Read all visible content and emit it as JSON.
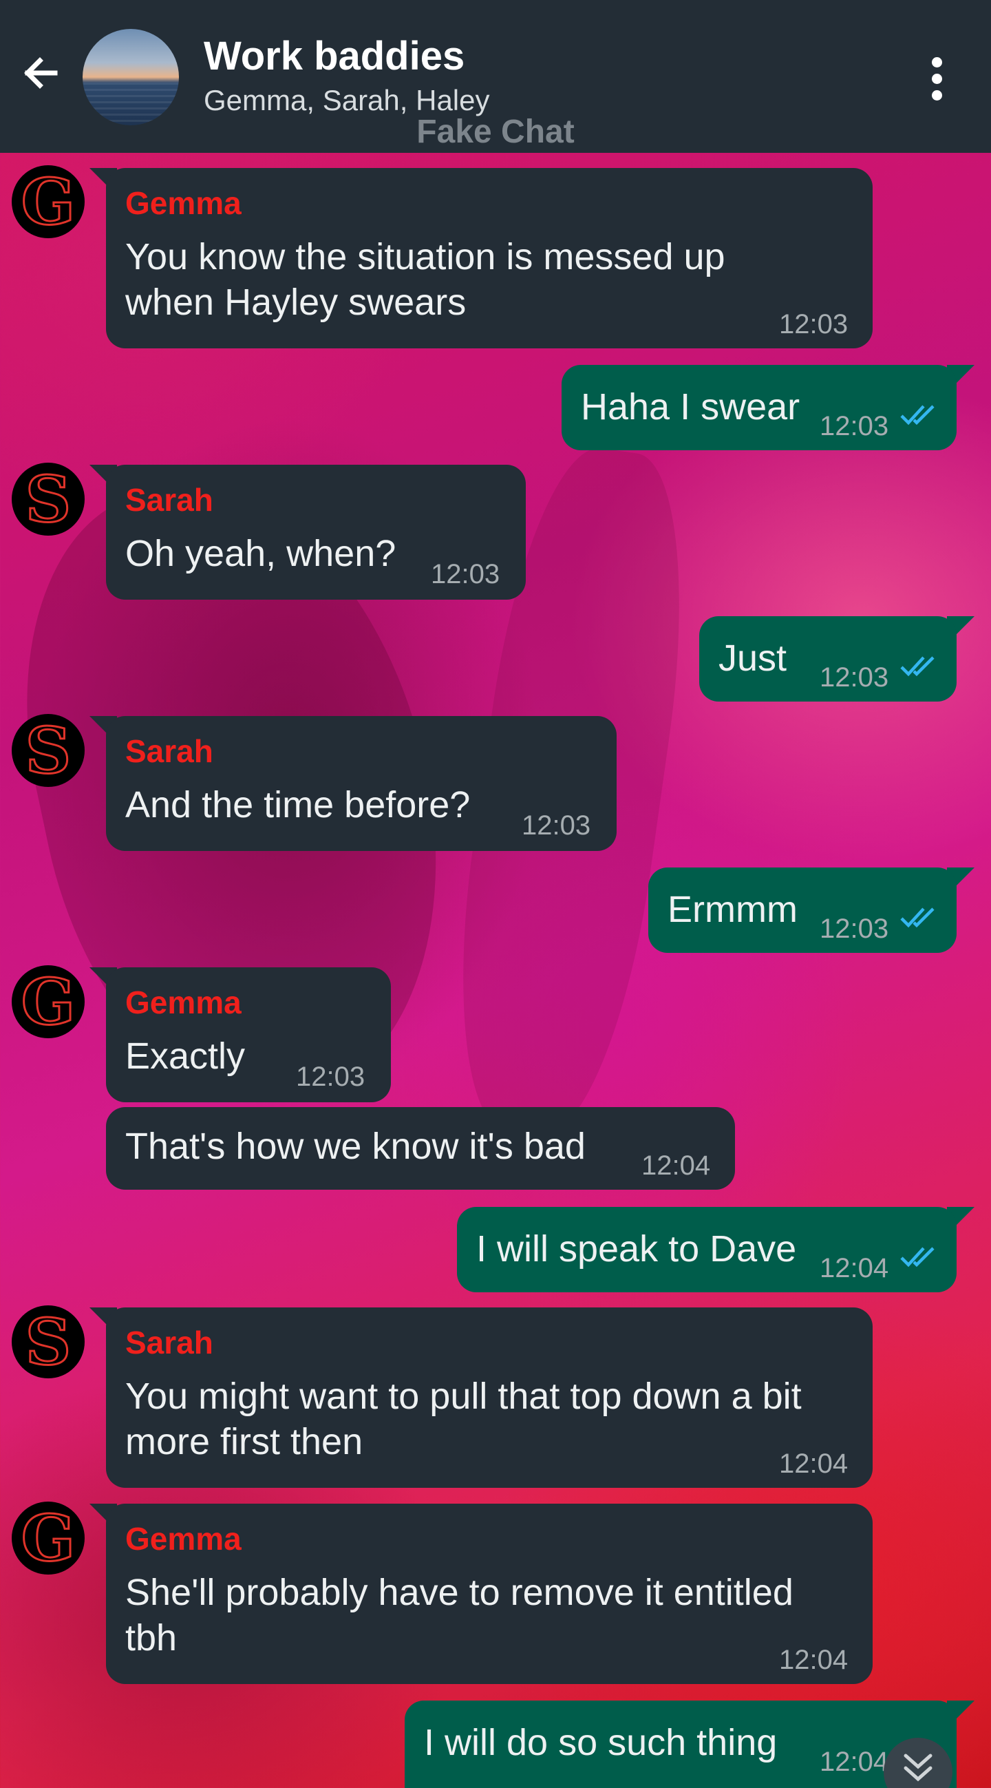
{
  "header": {
    "title": "Work baddies",
    "participants": "Gemma, Sarah, Haley",
    "watermark": "Fake Chat"
  },
  "messages": [
    {
      "sender": "Gemma",
      "avatar_letter": "G",
      "lines": [
        "You know the situation is messed up",
        "when Hayley swears"
      ],
      "time": "12:03"
    },
    {
      "direction": "out",
      "text": "Haha I swear",
      "time": "12:03",
      "status": "read"
    },
    {
      "sender": "Sarah",
      "avatar_letter": "S",
      "lines": [
        "Oh yeah, when?"
      ],
      "time": "12:03"
    },
    {
      "direction": "out",
      "text": "Just",
      "time": "12:03",
      "status": "read"
    },
    {
      "sender": "Sarah",
      "avatar_letter": "S",
      "lines": [
        "And the time before?"
      ],
      "time": "12:03"
    },
    {
      "direction": "out",
      "text": "Ermmm",
      "time": "12:03",
      "status": "read"
    },
    {
      "sender": "Gemma",
      "avatar_letter": "G",
      "lines": [
        "Exactly"
      ],
      "time": "12:03"
    },
    {
      "lines": [
        "That's how we know it's bad"
      ],
      "time": "12:04"
    },
    {
      "direction": "out",
      "text": "I will speak to Dave",
      "time": "12:04",
      "status": "read"
    },
    {
      "sender": "Sarah",
      "avatar_letter": "S",
      "lines": [
        "You might want to pull that top down a bit",
        "more first then"
      ],
      "time": "12:04"
    },
    {
      "sender": "Gemma",
      "avatar_letter": "G",
      "lines": [
        "She'll probably have to remove it entitled",
        "tbh"
      ],
      "time": "12:04"
    },
    {
      "direction": "out",
      "text": "I will do so such thing",
      "time": "12:04",
      "status": "read"
    }
  ],
  "colors": {
    "header_bg": "#232d36",
    "incoming_bubble": "#232d36",
    "outgoing_bubble": "#005d4b",
    "sender_name": "#f0201c",
    "read_ticks": "#34b7f1"
  },
  "icons": {
    "back": "arrow-left-icon",
    "menu": "more-vert-icon",
    "read_receipt": "double-check-icon",
    "scroll": "double-chevron-down-icon"
  }
}
